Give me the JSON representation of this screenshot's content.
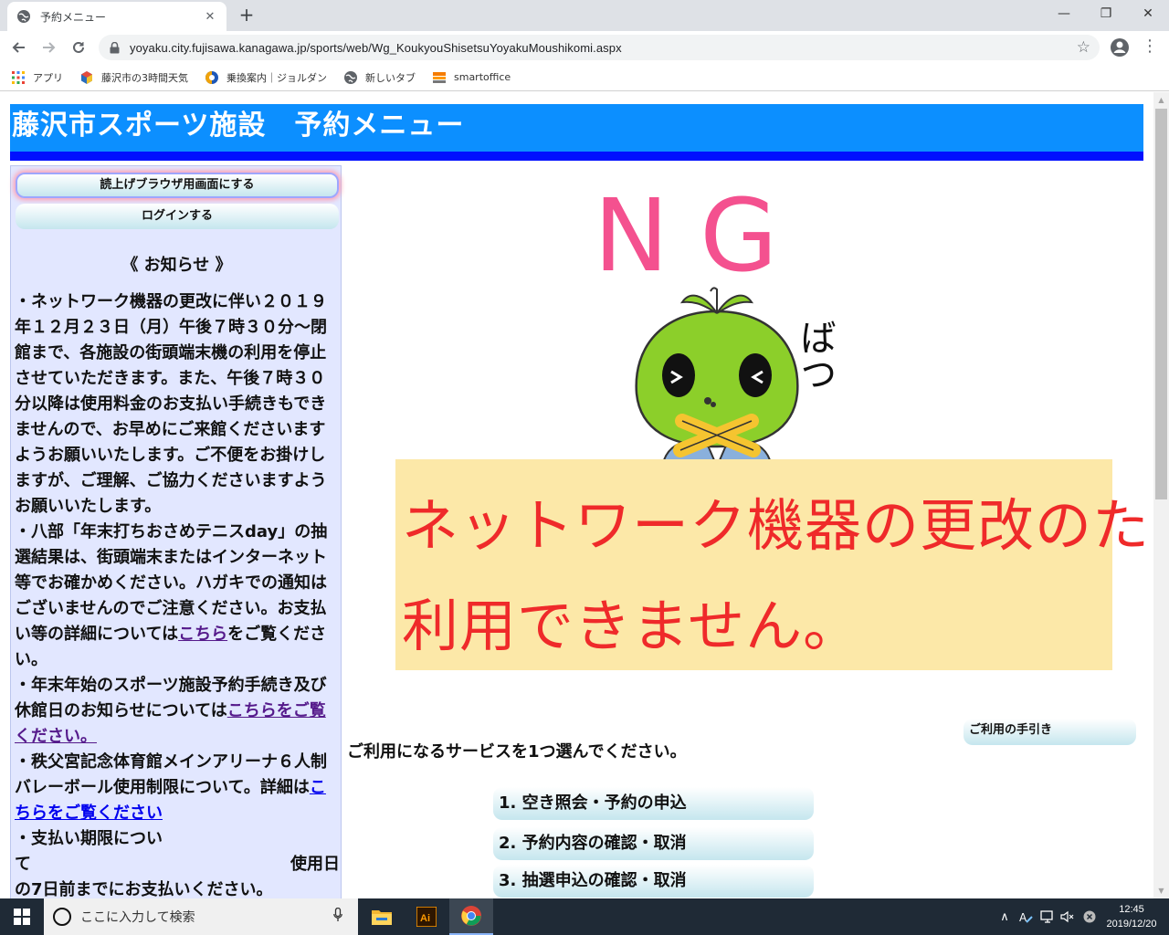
{
  "browser": {
    "tab_title": "予約メニュー",
    "url": "yoyaku.city.fujisawa.kanagawa.jp/sports/web/Wg_KoukyouShisetsuYoyakuMoushikomi.aspx",
    "bookmarks": [
      "アプリ",
      "藤沢市の3時間天気",
      "乗換案内｜ジョルダン",
      "新しいタブ",
      "smartoffice"
    ]
  },
  "page": {
    "header_title": "藤沢市スポーツ施設　予約メニュー",
    "sidebar": {
      "read_aloud_button": "読上げブラウザ用画面にする",
      "login_button": "ログインする",
      "notice_title": "《 お知らせ 》",
      "n1": "・ネットワーク機器の更改に伴い２０１９年１２月２３日（月）午後７時３０分～閉館まで、各施設の街頭端末機の利用を停止させていただきます。また、午後７時３０分以降は使用料金のお支払い手続きもできませんので、お早めにご来館くださいますようお願いいたします。ご不便をお掛けしますが、ご理解、ご協力くださいますようお願いいたします。",
      "n2_pre": "・八部「年末打ちおさめテニスday」の抽選結果は、街頭端末またはインターネット等でお確かめください。ハガキでの通知はございませんのでご注意ください。お支払い等の詳細については",
      "n2_link": "こちら",
      "n2_post": "をご覧ください。",
      "n3_pre": "・年末年始のスポーツ施設予約手続き及び休館日のお知らせについては",
      "n3_link": "こちらをご覧ください。",
      "n4_pre": "・秩父宮記念体育館メインアリーナ６人制バレーボール使用制限について。詳細は",
      "n4_link": "こちらをご覧ください",
      "n5": "・支払い期限につい",
      "n5_l2a": "て",
      "n5_l2b": "使用日",
      "n5_l3": "の7日前までにお支払いください。"
    },
    "ng": {
      "big": "NG",
      "side_text": "ばつ",
      "line1": "ネットワーク機器の更改のため",
      "line2": "利用できません。"
    },
    "guide_button": "ご利用の手引き",
    "service_prompt": "ご利用になるサービスを1つ選んでください。",
    "services": [
      "1. 空き照会・予約の申込",
      "2. 予約内容の確認・取消",
      "3. 抽選申込の確認・取消"
    ]
  },
  "taskbar": {
    "search_placeholder": "ここに入力して検索",
    "time": "12:45",
    "date": "2019/12/20"
  },
  "colors": {
    "header_blue": "#0c8fff",
    "stripe_blue": "#0010ff",
    "sidebar_bg": "#e2e7ff",
    "ng_pink": "#f4518f",
    "banner_bg": "#fce8a8",
    "banner_text": "#ef2a2a",
    "mascot_green": "#8ccf2a"
  },
  "icons": [
    "globe-icon",
    "back-arrow-icon",
    "forward-arrow-icon",
    "reload-icon",
    "lock-icon",
    "star-icon",
    "account-icon",
    "menu-kebab-icon",
    "windows-start-icon",
    "file-explorer-icon",
    "illustrator-icon",
    "chrome-icon"
  ]
}
